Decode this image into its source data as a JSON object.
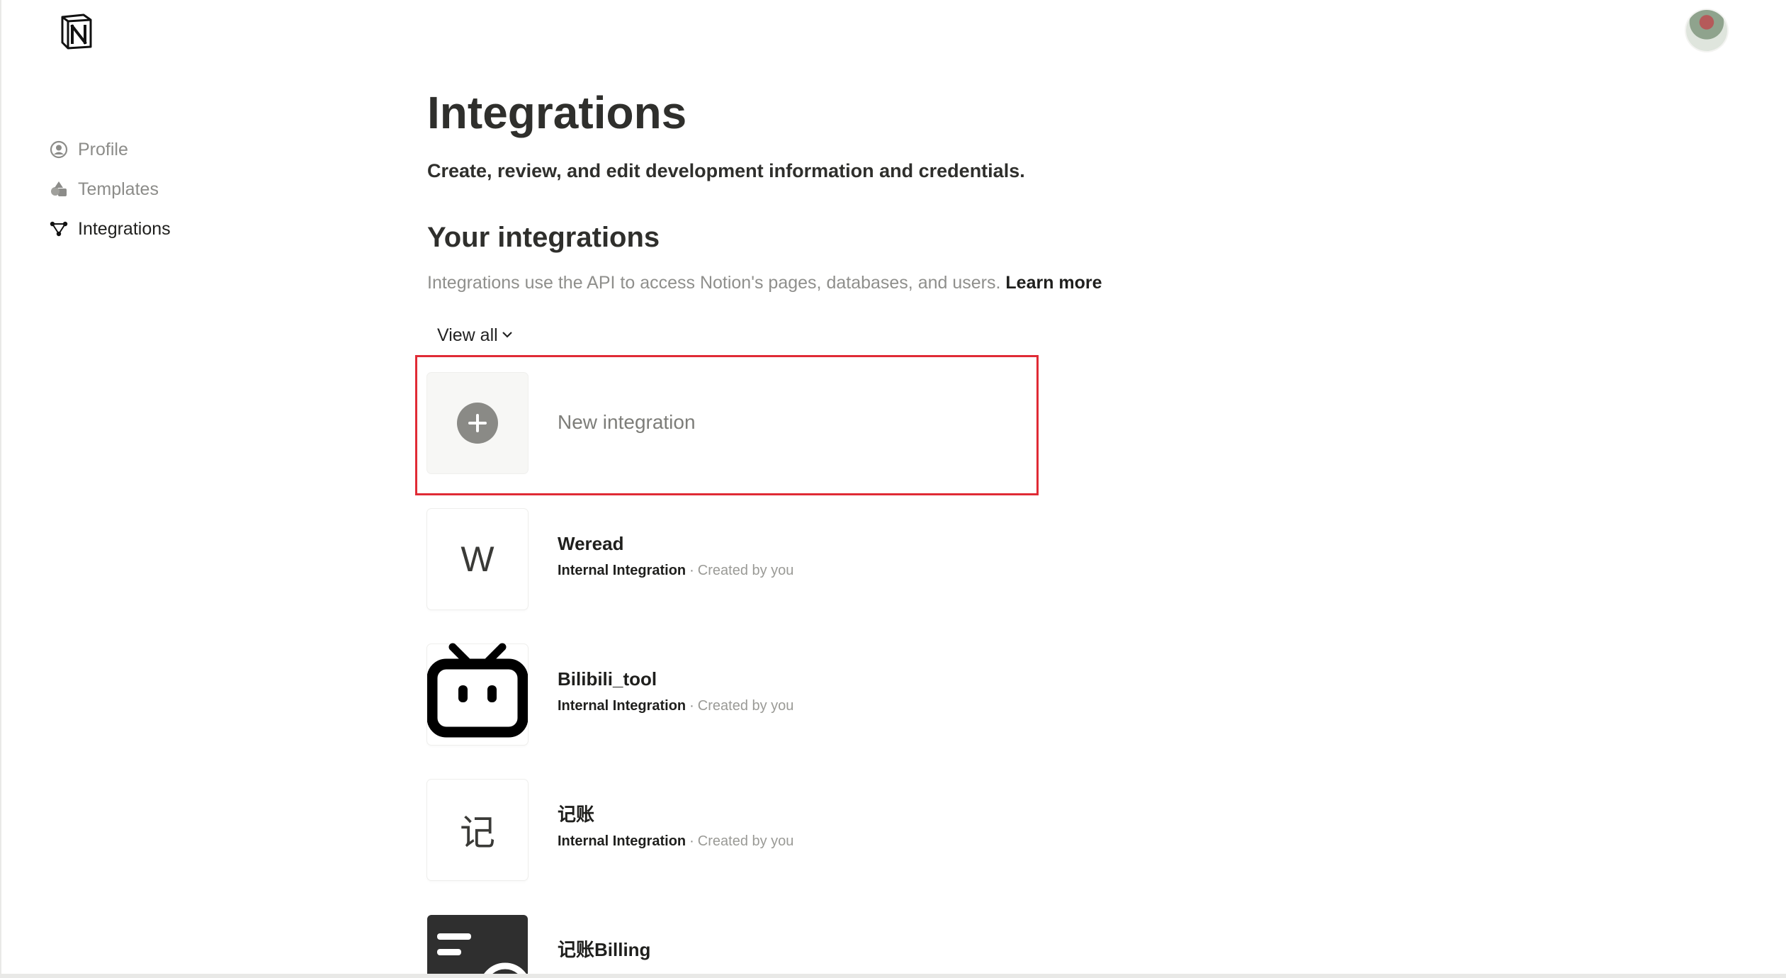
{
  "sidebar": {
    "items": [
      {
        "label": "Profile"
      },
      {
        "label": "Templates"
      },
      {
        "label": "Integrations"
      }
    ]
  },
  "main": {
    "title": "Integrations",
    "subtitle": "Create, review, and edit development information and credentials.",
    "section_title": "Your integrations",
    "section_desc": "Integrations use the API to access Notion's pages, databases, and users.",
    "learn_more": "Learn more",
    "filter_label": "View all"
  },
  "new_integration": {
    "label": "New integration"
  },
  "integrations": [
    {
      "name": "Weread",
      "icon_letter": "W",
      "type": "Internal Integration",
      "created": "Created by you"
    },
    {
      "name": "Bilibili_tool",
      "icon": "bilibili-icon",
      "type": "Internal Integration",
      "created": "Created by you"
    },
    {
      "name": "记账",
      "icon_letter": "记",
      "type": "Internal Integration",
      "created": "Created by you"
    },
    {
      "name": "记账Billing",
      "icon": "billing-icon"
    }
  ],
  "icons": {
    "logo": "notion-logo",
    "profile": "person-circle-icon",
    "templates": "shapes-icon",
    "integrations": "nodes-icon",
    "chevron": "chevron-down-icon",
    "add": "plus-circle-icon"
  },
  "colors": {
    "highlight": "#e02b35",
    "text_primary": "#1f1f1d",
    "text_secondary": "#8f8f8c"
  }
}
